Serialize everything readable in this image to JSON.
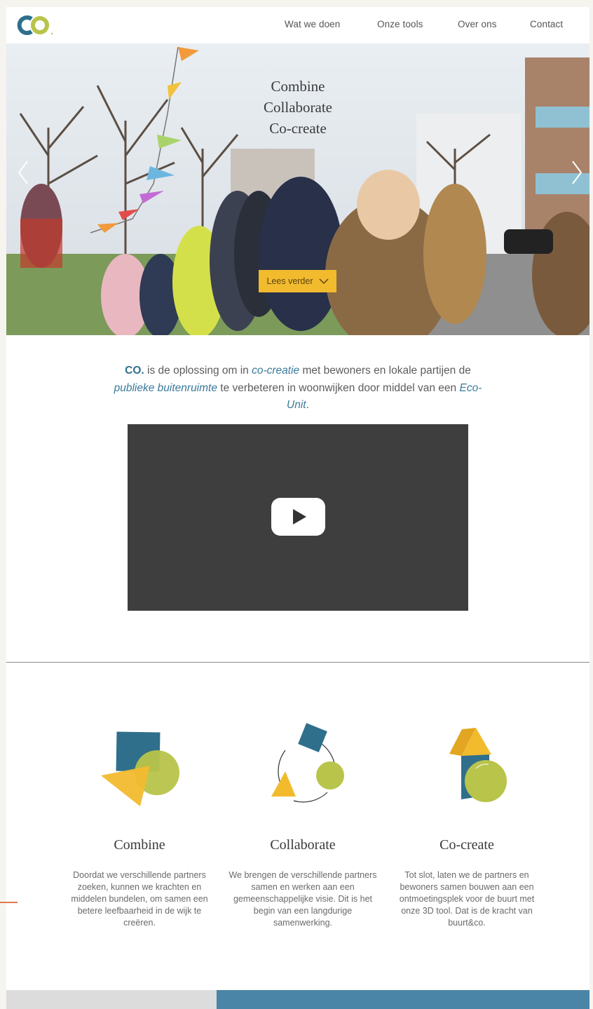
{
  "brand": {
    "logo_text": "CO",
    "colors": {
      "teal": "#2f6f8c",
      "green": "#b8c44a",
      "yellow": "#f2bb2e",
      "blue": "#4a84a6"
    }
  },
  "nav": [
    "Wat we doen",
    "Onze tools",
    "Over ons",
    "Contact"
  ],
  "hero": {
    "title_lines": [
      "Combine",
      "Collaborate",
      "Co-create"
    ],
    "button_label": "Lees verder",
    "prev_icon": "chevron-left-icon",
    "next_icon": "chevron-right-icon"
  },
  "intro": {
    "brand": "CO.",
    "t1": " is de oplossing om in ",
    "link1": "co-creatie",
    "t2": " met bewoners en lokale partijen de ",
    "link2": "publieke buitenruimte",
    "t3": " te verbeteren in woonwijken door middel van een ",
    "link3": "Eco-Unit",
    "t4": "."
  },
  "video": {
    "icon": "play-icon"
  },
  "features": [
    {
      "title": "Combine",
      "text": "Doordat we verschillende partners zoeken, kunnen we krachten en middelen bundelen, om samen een betere leefbaarheid in de wijk te creëren."
    },
    {
      "title": "Collaborate",
      "text": "We brengen de verschillende partners samen en werken aan een gemeenschappelijke visie. Dit is het begin van een langdurige samenwerking."
    },
    {
      "title": "Co-create",
      "text": "Tot slot, laten we de partners en bewoners samen bouwen aan een ontmoetingsplek voor de buurt met onze 3D tool. Dat is de kracht van buurt&co."
    }
  ]
}
